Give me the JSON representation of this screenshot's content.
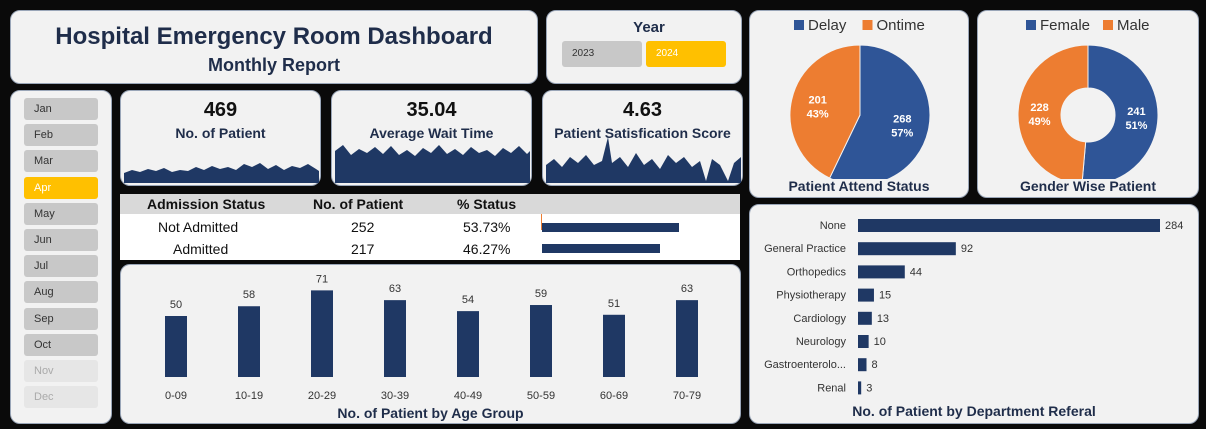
{
  "header": {
    "title": "Hospital Emergency Room Dashboard",
    "subtitle": "Monthly Report"
  },
  "year_filter": {
    "label": "Year",
    "options": [
      "2023",
      "2024"
    ],
    "selected": "2024"
  },
  "month_filter": {
    "months": [
      "Jan",
      "Feb",
      "Mar",
      "Apr",
      "May",
      "Jun",
      "Jul",
      "Aug",
      "Sep",
      "Oct",
      "Nov",
      "Dec"
    ],
    "selected": "Apr",
    "disabled": [
      "Nov",
      "Dec"
    ]
  },
  "kpis": [
    {
      "value": "469",
      "label": "No. of Patient"
    },
    {
      "value": "35.04",
      "label": "Average Wait Time"
    },
    {
      "value": "4.63",
      "label": "Patient Satisfication Score"
    }
  ],
  "admission": {
    "headers": [
      "Admission Status",
      "No. of Patient",
      "% Status"
    ],
    "rows": [
      {
        "status": "Not Admitted",
        "count": "252",
        "pct": "53.73%",
        "share": 0.5373
      },
      {
        "status": "Admitted",
        "count": "217",
        "pct": "46.27%",
        "share": 0.4627
      }
    ]
  },
  "colors": {
    "navy": "#1f3864",
    "blue": "#2f5597",
    "orange": "#ed7d31",
    "gold": "#ffc000"
  },
  "chart_data": [
    {
      "type": "pie",
      "title": "Patient Attend Status",
      "legend": [
        "Delay",
        "Ontime"
      ],
      "legend_position": "top",
      "slices": [
        {
          "name": "Delay",
          "value": 268,
          "label": "268",
          "pct": "57%",
          "color": "#2f5597"
        },
        {
          "name": "Ontime",
          "value": 201,
          "label": "201",
          "pct": "43%",
          "color": "#ed7d31"
        }
      ]
    },
    {
      "type": "pie",
      "title": "Gender Wise Patient",
      "legend": [
        "Female",
        "Male"
      ],
      "legend_position": "top",
      "donut": true,
      "slices": [
        {
          "name": "Female",
          "value": 241,
          "label": "241",
          "pct": "51%",
          "color": "#2f5597"
        },
        {
          "name": "Male",
          "value": 228,
          "label": "228",
          "pct": "49%",
          "color": "#ed7d31"
        }
      ]
    },
    {
      "type": "bar",
      "title": "No. of Patient by  Age Group",
      "categories": [
        "0-09",
        "10-19",
        "20-29",
        "30-39",
        "40-49",
        "50-59",
        "60-69",
        "70-79"
      ],
      "values": [
        50,
        58,
        71,
        63,
        54,
        59,
        51,
        63
      ],
      "ylim": [
        0,
        80
      ],
      "grid": false
    },
    {
      "type": "bar",
      "orientation": "horizontal",
      "title": "No. of Patient by Department Referal",
      "categories": [
        "None",
        "General Practice",
        "Orthopedics",
        "Physiotherapy",
        "Cardiology",
        "Neurology",
        "Gastroenterolo...",
        "Renal"
      ],
      "values": [
        284,
        92,
        44,
        15,
        13,
        10,
        8,
        3
      ],
      "xlim": [
        0,
        284
      ],
      "grid": false
    }
  ]
}
